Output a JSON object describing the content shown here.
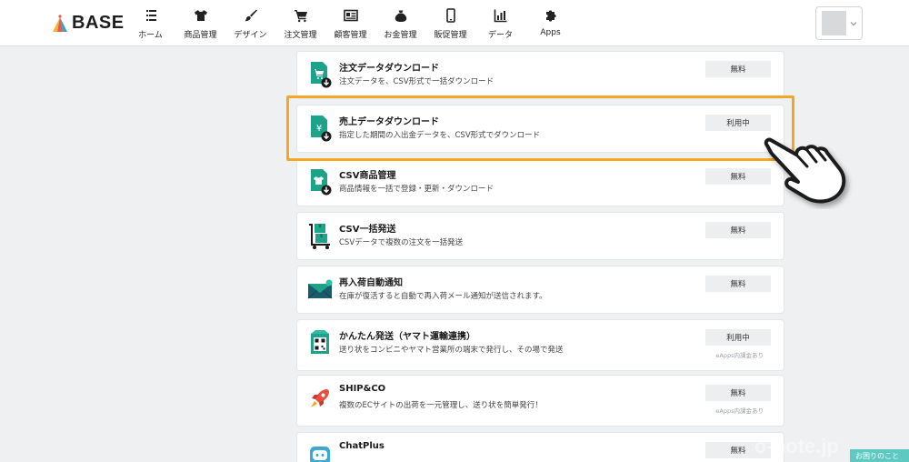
{
  "header": {
    "logo_text": "BASE",
    "nav": [
      {
        "key": "home",
        "label": "ホーム",
        "icon": "list-icon"
      },
      {
        "key": "products",
        "label": "商品管理",
        "icon": "tshirt-icon"
      },
      {
        "key": "design",
        "label": "デザイン",
        "icon": "brush-icon"
      },
      {
        "key": "orders",
        "label": "注文管理",
        "icon": "cart-icon"
      },
      {
        "key": "customers",
        "label": "顧客管理",
        "icon": "id-card-icon"
      },
      {
        "key": "money",
        "label": "お金管理",
        "icon": "money-bag-icon"
      },
      {
        "key": "promo",
        "label": "販促管理",
        "icon": "smartphone-icon"
      },
      {
        "key": "data",
        "label": "データ",
        "icon": "bar-chart-icon"
      },
      {
        "key": "apps",
        "label": "Apps",
        "icon": "puzzle-icon"
      }
    ]
  },
  "apps": [
    {
      "title": "注文データダウンロード",
      "desc": "注文データを、CSV形式で一括ダウンロード",
      "badge": "無料",
      "note": "",
      "icon": "order-download-icon"
    },
    {
      "title": "売上データダウンロード",
      "desc": "指定した期間の入出金データを、CSV形式でダウンロード",
      "badge": "利用中",
      "note": "",
      "icon": "sales-download-icon"
    },
    {
      "title": "CSV商品管理",
      "desc": "商品情報を一括で登録・更新・ダウンロード",
      "badge": "無料",
      "note": "",
      "icon": "csv-product-icon"
    },
    {
      "title": "CSV一括発送",
      "desc": "CSVデータで複数の注文を一括発送",
      "badge": "無料",
      "note": "",
      "icon": "shipping-cart-icon"
    },
    {
      "title": "再入荷自動通知",
      "desc": "在庫が復活すると自動で再入荷メール通知が送信されます。",
      "badge": "無料",
      "note": "",
      "icon": "mail-notice-icon"
    },
    {
      "title": "かんたん発送（ヤマト運輸連携）",
      "desc": "送り状をコンビニやヤマト営業所の端末で発行し、その場で発送",
      "badge": "利用中",
      "note": "eApps内課金あり",
      "icon": "qr-code-icon"
    },
    {
      "title": "SHIP&CO",
      "desc": "複数のECサイトの出荷を一元管理し、送り状を簡単発行！",
      "badge": "無料",
      "note": "eApps内課金あり",
      "icon": "rocket-icon"
    },
    {
      "title": "ChatPlus",
      "desc": "",
      "badge": "無料",
      "note": "",
      "icon": "chat-bot-icon"
    }
  ],
  "help_tab": "お困りのこと",
  "watermark": "o-note.jp",
  "colors": {
    "highlight": "#f5a623",
    "teal": "#1fa28a",
    "help": "#5dc9c0"
  }
}
